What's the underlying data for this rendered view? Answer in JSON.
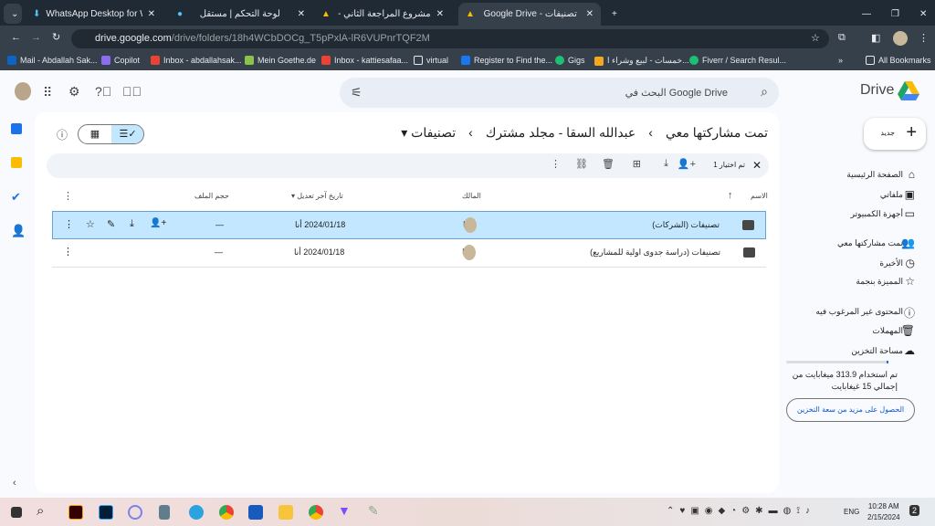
{
  "browser": {
    "tabs": [
      {
        "title": "WhatsApp Desktop for Window"
      },
      {
        "title": "لوحة التحكم | مستقل"
      },
      {
        "title": "مشروع المراجعة الثاني - Google Drive"
      },
      {
        "title": "Google Drive - تصنيفات"
      }
    ],
    "url_host": "drive.google.com",
    "url_path": "/drive/folders/18h4WCbDOCg_T5pPxlA-lR6VUPnrTQF2M",
    "bookmarks": [
      "Mail - Abdallah Sak...",
      "Copilot",
      "Inbox - abdallahsak...",
      "Mein Goethe.de",
      "Inbox - kattiesafaa...",
      "virtual",
      "Register to Find the...",
      "Gigs",
      "خمسات - لبيع وشراء ا...",
      "Fiverr / Search Resul..."
    ],
    "all_bookmarks": "All Bookmarks"
  },
  "drive": {
    "logo": "Drive",
    "search_placeholder": "البحث في Google Drive",
    "new_label": "جديد",
    "nav": [
      {
        "label": "الصفحة الرئيسية",
        "icon": "home-icon"
      },
      {
        "label": "ملفاتي",
        "icon": "my-drive-icon"
      },
      {
        "label": "أجهزة الكمبيوتر",
        "icon": "computers-icon"
      },
      {
        "label": "تمت مشاركتها معي",
        "icon": "shared-icon"
      },
      {
        "label": "الأخيرة",
        "icon": "clock-icon"
      },
      {
        "label": "المميزة بنجمة",
        "icon": "star-icon"
      },
      {
        "label": "المحتوى غير المرغوب فيه",
        "icon": "spam-icon"
      },
      {
        "label": "المهملات",
        "icon": "trash-icon"
      },
      {
        "label": "مساحة التخزين",
        "icon": "cloud-icon"
      }
    ],
    "storage_text": "تم استخدام 313.9 ميغابايت من إجمالي 15 غيغابايت",
    "storage_fraction": 0.02,
    "storage_button": "الحصول على مزيد من سعة التخزين",
    "breadcrumb": [
      "تمت مشاركتها معي",
      "عبدالله السقا - مجلد مشترك",
      "تصنيفات"
    ],
    "selection_text": "تم اختيار 1",
    "columns": {
      "name": "الاسم",
      "owner": "المالك",
      "modified": "تاريخ آخر تعديل",
      "size": "حجم الملف"
    },
    "rows": [
      {
        "name": "تصنيفات (الشركات)",
        "owner": "أنا",
        "modified": "2024/01/18 أنا",
        "size": "—",
        "selected": true
      },
      {
        "name": "تصنيفات (دراسة جدوى اولية للمشاريع)",
        "owner": "أنا",
        "modified": "2024/01/18 أنا",
        "size": "—",
        "selected": false
      }
    ]
  },
  "taskbar": {
    "lang": "ENG",
    "time": "10:28 AM",
    "date": "2/15/2024",
    "notifications": "2"
  }
}
